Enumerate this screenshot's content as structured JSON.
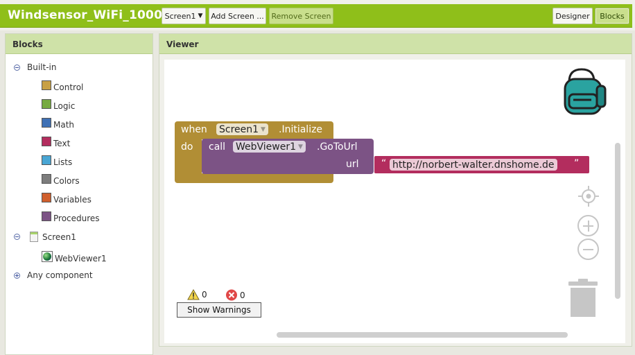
{
  "app": {
    "title": "Windsensor_WiFi_1000"
  },
  "toolbar": {
    "screen_select": "Screen1",
    "add_screen": "Add Screen ...",
    "remove_screen": "Remove Screen",
    "designer": "Designer",
    "blocks": "Blocks"
  },
  "blocks_panel": {
    "title": "Blocks",
    "builtin_label": "Built-in",
    "categories": [
      {
        "label": "Control",
        "color": "#c8a044"
      },
      {
        "label": "Logic",
        "color": "#77ab41"
      },
      {
        "label": "Math",
        "color": "#3f71b5"
      },
      {
        "label": "Text",
        "color": "#b32d5e"
      },
      {
        "label": "Lists",
        "color": "#49a6d4"
      },
      {
        "label": "Colors",
        "color": "#7d7d7d"
      },
      {
        "label": "Variables",
        "color": "#d05f2d"
      },
      {
        "label": "Procedures",
        "color": "#7c5385"
      }
    ],
    "screen_label": "Screen1",
    "component_label": "WebViewer1",
    "any_component_label": "Any component"
  },
  "viewer": {
    "title": "Viewer",
    "event_block": {
      "when": "when",
      "component": "Screen1",
      "event": ".Initialize",
      "do": "do",
      "color": "#b18e35"
    },
    "call_block": {
      "call": "call",
      "component": "WebViewer1",
      "method": ".GoToUrl",
      "param": "url",
      "color": "#7c5385"
    },
    "text_block": {
      "open_quote": "“",
      "value": "http://norbert-walter.dnshome.de",
      "close_quote": "”",
      "color": "#b32d5e"
    },
    "warnings_count": "0",
    "errors_count": "0",
    "show_warnings": "Show Warnings"
  }
}
